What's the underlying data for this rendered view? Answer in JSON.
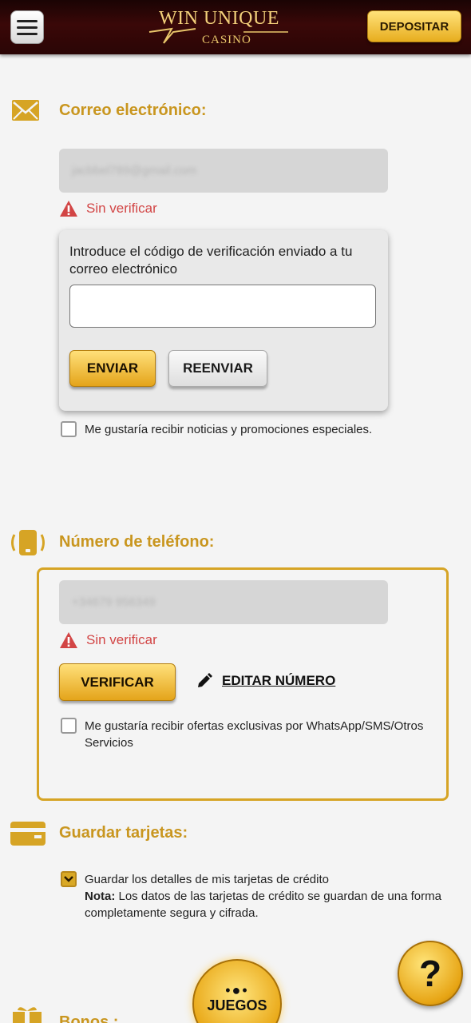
{
  "header": {
    "logo_text": "WIN UNIQUE",
    "logo_sub": "CASINO",
    "deposit_label": "DEPOSITAR"
  },
  "email": {
    "title": "Correo electrónico:",
    "masked_value": "jacbbel789@gmail.com",
    "status": "Sin verificar",
    "verify_text": "Introduce el código de verificación enviado a tu correo electrónico",
    "code_value": "",
    "send_label": "ENVIAR",
    "resend_label": "REENVIAR",
    "newsletter_label": "Me gustaría recibir noticias y promociones especiales."
  },
  "phone": {
    "title": "Número de teléfono:",
    "masked_value": "+34679 956349",
    "status": "Sin verificar",
    "verify_label": "VERIFICAR",
    "edit_label": "EDITAR NÚMERO",
    "offers_label": "Me gustaría recibir ofertas exclusivas por WhatsApp/SMS/Otros Servicios"
  },
  "cards": {
    "title": "Guardar tarjetas:",
    "save_label": "Guardar los detalles de mis tarjetas de crédito",
    "note_bold": "Nota:",
    "note_text": " Los datos de las tarjetas de crédito se guardan de una forma completamente segura y cifrada."
  },
  "bonus": {
    "title": "Bonos :"
  },
  "floating": {
    "help_label": "?",
    "games_dots": "•●•",
    "games_label": "JUEGOS"
  },
  "colors": {
    "accent": "#c9961f",
    "warning": "#d24545",
    "header_bg": "#3a0808"
  }
}
